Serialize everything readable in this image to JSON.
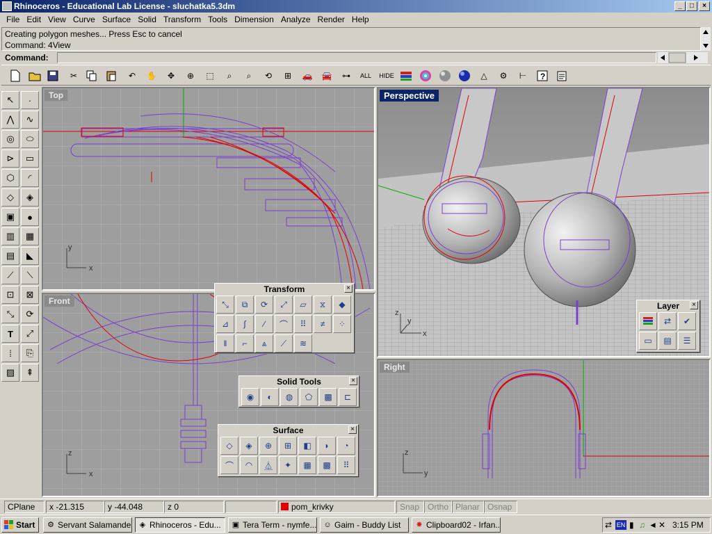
{
  "window": {
    "title": "Rhinoceros - Educational Lab License - sluchatka5.3dm",
    "btn_min": "_",
    "btn_max": "□",
    "btn_close": "×"
  },
  "menu": [
    "File",
    "Edit",
    "View",
    "Curve",
    "Surface",
    "Solid",
    "Transform",
    "Tools",
    "Dimension",
    "Analyze",
    "Render",
    "Help"
  ],
  "history": {
    "line1": "Creating polygon meshes... Press Esc to cancel",
    "line2": "Command: 4View"
  },
  "command": {
    "label": "Command:",
    "value": ""
  },
  "toolbar": {
    "all_label": "ALL",
    "hide_label": "HIDE"
  },
  "viewports": {
    "top": "Top",
    "front": "Front",
    "perspective": "Perspective",
    "right": "Right"
  },
  "axes": {
    "x": "x",
    "y": "y",
    "z": "z"
  },
  "panels": {
    "transform": "Transform",
    "solid_tools": "Solid Tools",
    "surface": "Surface",
    "layer": "Layer"
  },
  "status": {
    "cplane": "CPlane",
    "x": "x -21.315",
    "y": "y -44.048",
    "z": "z 0",
    "layer": "pom_krivky",
    "layer_color": "#e00000",
    "snap": "Snap",
    "ortho": "Ortho",
    "planar": "Planar",
    "osnap": "Osnap"
  },
  "taskbar": {
    "start": "Start",
    "tasks": [
      "Servant Salamander",
      "Rhinoceros - Edu...",
      "Tera Term - nymfe...",
      "Gaim - Buddy List",
      "Clipboard02 - Irfan..."
    ],
    "lang": "EN",
    "clock": "3:15 PM"
  },
  "colors": {
    "accent": "#0a246a",
    "curve_red": "#e00000",
    "mesh_purple": "#7a3fd0"
  }
}
